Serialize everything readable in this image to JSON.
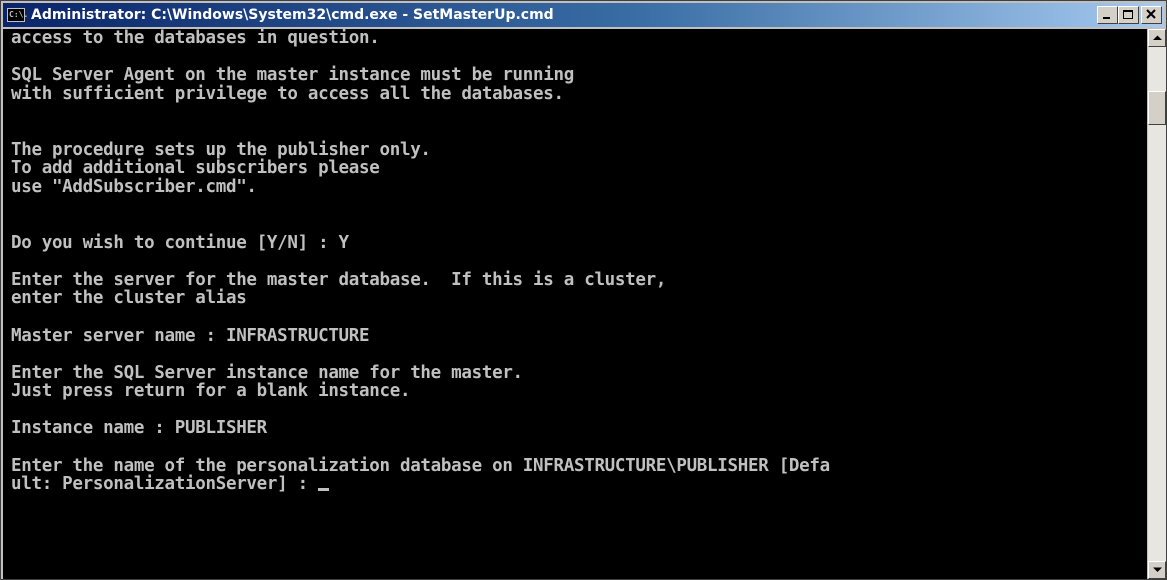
{
  "window": {
    "title": "Administrator: C:\\Windows\\System32\\cmd.exe - SetMasterUp.cmd",
    "icon": "console-icon",
    "icon_text": "C:\\."
  },
  "console": {
    "lines": [
      "access to the databases in question.",
      "",
      "SQL Server Agent on the master instance must be running",
      "with sufficient privilege to access all the databases.",
      "",
      "",
      "The procedure sets up the publisher only.",
      "To add additional subscribers please",
      "use \"AddSubscriber.cmd\".",
      "",
      "",
      "Do you wish to continue [Y/N] : Y",
      "",
      "Enter the server for the master database.  If this is a cluster,",
      "enter the cluster alias",
      "",
      "Master server name : INFRASTRUCTURE",
      "",
      "Enter the SQL Server instance name for the master.",
      "Just press return for a blank instance.",
      "",
      "Instance name : PUBLISHER",
      "",
      "Enter the name of the personalization database on INFRASTRUCTURE\\PUBLISHER [Defa",
      "ult: PersonalizationServer] : "
    ]
  },
  "colors": {
    "console_bg": "#000000",
    "console_fg": "#c0c0c0",
    "titlebar_start": "#0a246a",
    "titlebar_end": "#a6caf0"
  }
}
